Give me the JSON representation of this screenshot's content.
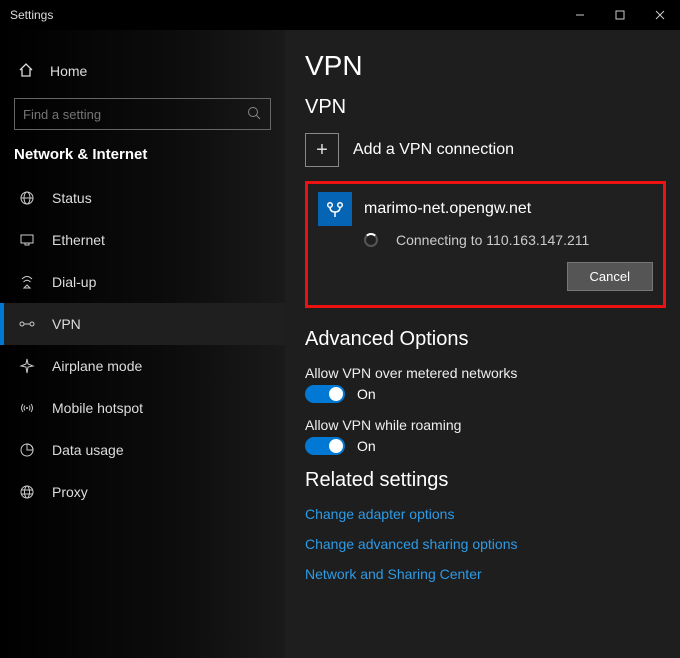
{
  "window": {
    "title": "Settings"
  },
  "sidebar": {
    "home": "Home",
    "search_placeholder": "Find a setting",
    "section": "Network & Internet",
    "items": [
      {
        "label": "Status"
      },
      {
        "label": "Ethernet"
      },
      {
        "label": "Dial-up"
      },
      {
        "label": "VPN",
        "selected": true
      },
      {
        "label": "Airplane mode"
      },
      {
        "label": "Mobile hotspot"
      },
      {
        "label": "Data usage"
      },
      {
        "label": "Proxy"
      }
    ]
  },
  "main": {
    "h1": "VPN",
    "h2": "VPN",
    "add_label": "Add a VPN connection",
    "connection": {
      "name": "marimo-net.opengw.net",
      "status": "Connecting to 110.163.147.211",
      "cancel": "Cancel"
    },
    "advanced_heading": "Advanced Options",
    "opts": [
      {
        "label": "Allow VPN over metered networks",
        "state": "On"
      },
      {
        "label": "Allow VPN while roaming",
        "state": "On"
      }
    ],
    "related_heading": "Related settings",
    "links": [
      "Change adapter options",
      "Change advanced sharing options",
      "Network and Sharing Center"
    ]
  }
}
